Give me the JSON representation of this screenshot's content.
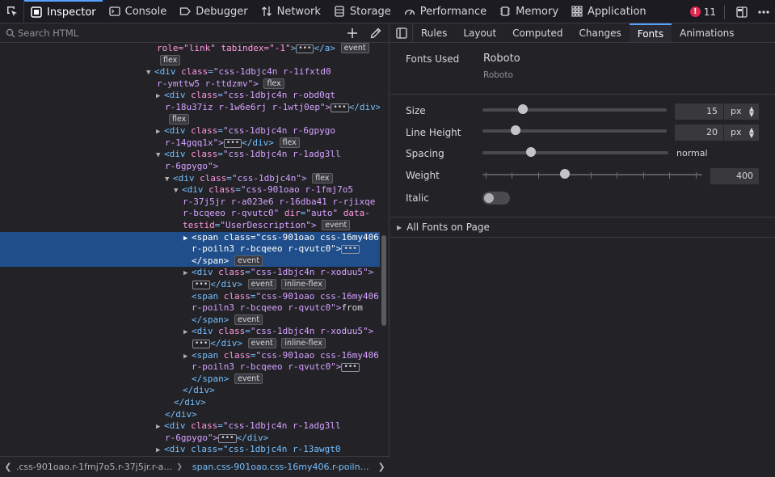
{
  "toolbar": {
    "tabs": [
      "Inspector",
      "Console",
      "Debugger",
      "Network",
      "Storage",
      "Performance",
      "Memory",
      "Application"
    ],
    "error_count": "11"
  },
  "markup": {
    "search_placeholder": "Search HTML",
    "lines": [
      {
        "t0": "role=\"link\" tabindex=\"-1\"",
        "b": "event"
      },
      {
        "b": "flex"
      },
      {
        "tag": "div",
        "an": "class",
        "av": "css-1dbjc4n r-1ifxtd0"
      },
      {
        "av": "r-ymttw5 r-ttdzmv\">",
        "b": "flex"
      },
      {
        "tag": "div",
        "an": "class",
        "av": "css-1dbjc4n r-obd0qt"
      },
      {
        "av": "r-18u37iz r-1w6e6rj r-1wtj0ep\">",
        "close": "</div>"
      },
      {
        "b": "flex"
      },
      {
        "tag": "div",
        "an": "class",
        "av": "css-1dbjc4n r-6gpygo"
      },
      {
        "av": "r-14gqq1x\">",
        "close": "</div>",
        "b": "flex"
      },
      {
        "tag": "div",
        "an": "class",
        "av": "css-1dbjc4n r-1adg3ll"
      },
      {
        "av": "r-6gpygo\">"
      },
      {
        "tag": "div",
        "an": "class",
        "av": "css-1dbjc4n\">",
        "b": "flex"
      },
      {
        "tag": "div",
        "an": "class",
        "av": "css-901oao r-1fmj7o5"
      },
      {
        "av": "r-37j5jr r-a023e6 r-16dba41 r-rjixqe"
      },
      {
        "av": "r-bcqeeo r-qvutc0\"",
        "an2": "dir",
        "av2": "\"auto\"",
        "an3": "data-"
      },
      {
        "an": "testid",
        "av": "\"UserDescription\">",
        "b": "event"
      },
      {
        "tag": "span",
        "an": "class",
        "av": "css-901oao css-16my406"
      },
      {
        "av": "r-poiln3 r-bcqeeo r-qvutc0\">"
      },
      {
        "close": "</span>",
        "b": "event"
      },
      {
        "tag": "div",
        "an": "class",
        "av": "css-1dbjc4n r-xoduu5\">"
      },
      {
        "close": "</div>",
        "b": "event",
        "b2": "inline-flex"
      },
      {
        "tag": "span",
        "an": "class",
        "av": "css-901oao css-16my406"
      },
      {
        "av": "r-poiln3 r-bcqeeo r-qvutc0\">",
        "txt": "from"
      },
      {
        "close": "</span>",
        "b": "event"
      },
      {
        "tag": "div",
        "an": "class",
        "av": "css-1dbjc4n r-xoduu5\">"
      },
      {
        "close": "</div>",
        "b": "event",
        "b2": "inline-flex"
      },
      {
        "tag": "span",
        "an": "class",
        "av": "css-901oao css-16my406"
      },
      {
        "av": "r-poiln3 r-bcqeeo r-qvutc0\">"
      },
      {
        "close": "</span>",
        "b": "event"
      },
      {
        "close": "</div>"
      },
      {
        "close": "</div>"
      },
      {
        "close": "</div>"
      },
      {
        "tag": "div",
        "an": "class",
        "av": "css-1dbjc4n r-1adg3ll"
      },
      {
        "av": "r-6gpygo\">",
        "close": "</div>"
      },
      {
        "partial": "<div class=\"css-1dbjc4n r-13awgt0"
      }
    ]
  },
  "breadcrumb": {
    "items": [
      ".css-901oao.r-1fmj7o5.r-37j5jr.r-a023e6.r-16dba41.r-rjixqe",
      "span.css-901oao.css-16my406.r-poiln3.r-bcqeeo.r-qvutc0"
    ]
  },
  "sidebar": {
    "tabs": [
      "Rules",
      "Layout",
      "Computed",
      "Changes",
      "Fonts",
      "Animations"
    ],
    "active_tab": "Fonts"
  },
  "fonts": {
    "used_label": "Fonts Used",
    "font_name": "Roboto",
    "font_sub": "Roboto",
    "size_label": "Size",
    "size_value": "15",
    "size_unit": "px",
    "size_fraction": 0.22,
    "lineheight_label": "Line Height",
    "lineheight_value": "20",
    "lineheight_unit": "px",
    "lineheight_fraction": 0.18,
    "spacing_label": "Spacing",
    "spacing_value": "normal",
    "spacing_fraction": 0.26,
    "weight_label": "Weight",
    "weight_value": "400",
    "weight_fraction": 0.375,
    "italic_label": "Italic",
    "italic_on": false,
    "all_fonts_label": "All Fonts on Page"
  },
  "colors": {
    "accent": "#54a3ff",
    "selection": "#204e8a",
    "error": "#e22850"
  }
}
